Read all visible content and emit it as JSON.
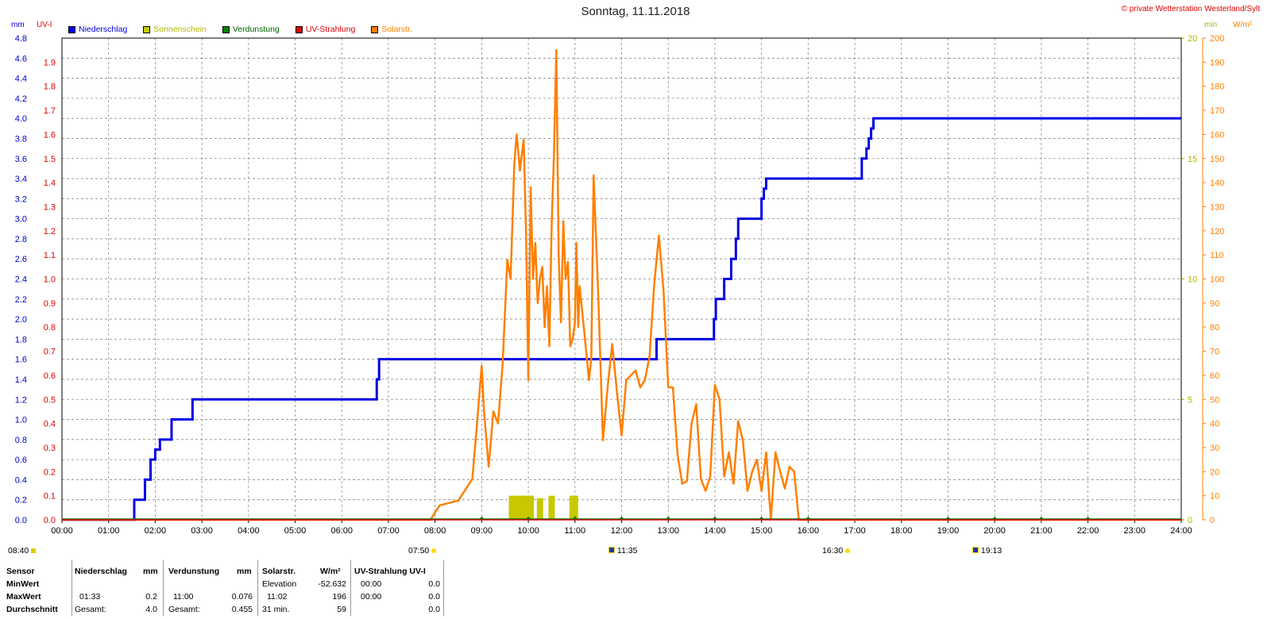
{
  "title": "Sonntag, 11.11.2018",
  "copyright": "© private Wetterstation Westerland/Sylt",
  "units": {
    "left1": "mm",
    "left2": "UV-I",
    "right1": "min",
    "right2": "W/m²"
  },
  "colors": {
    "niederschlag": "#0000e6",
    "sonnenschein": "#c8c800",
    "verdunstung": "#008000",
    "uv": "#e00000",
    "solar": "#ff7f00",
    "sonnenschein_axis": "#b4b400",
    "solar_axis": "#ff7f00"
  },
  "legend": [
    {
      "label": "Niederschlag",
      "color": "#0000e6"
    },
    {
      "label": "Sonnenschein",
      "color": "#c8c800"
    },
    {
      "label": "Verdunstung",
      "color": "#008000"
    },
    {
      "label": "UV-Strahlung",
      "color": "#e00000"
    },
    {
      "label": "Solarstr.",
      "color": "#ff7f00"
    }
  ],
  "chart_data": {
    "type": "line",
    "title": "Sonntag, 11.11.2018",
    "xlim": [
      0,
      24
    ],
    "x_ticks": [
      "00:00",
      "01:00",
      "02:00",
      "03:00",
      "04:00",
      "05:00",
      "06:00",
      "07:00",
      "08:00",
      "09:00",
      "10:00",
      "11:00",
      "12:00",
      "13:00",
      "14:00",
      "15:00",
      "16:00",
      "17:00",
      "18:00",
      "19:00",
      "20:00",
      "21:00",
      "22:00",
      "23:00",
      "24:00"
    ],
    "axes": {
      "mm": {
        "range": [
          0,
          4.8
        ],
        "ticks": [
          "0.0",
          "0.2",
          "0.4",
          "0.6",
          "0.8",
          "1.0",
          "1.2",
          "1.4",
          "1.6",
          "1.8",
          "2.0",
          "2.2",
          "2.4",
          "2.6",
          "2.8",
          "3.0",
          "3.2",
          "3.4",
          "3.6",
          "3.8",
          "4.0",
          "4.2",
          "4.4",
          "4.6",
          "4.8"
        ]
      },
      "uv": {
        "range": [
          0,
          2.0
        ],
        "ticks": [
          "0.0",
          "0.1",
          "0.2",
          "0.3",
          "0.4",
          "0.5",
          "0.6",
          "0.7",
          "0.8",
          "0.9",
          "1.0",
          "1.1",
          "1.2",
          "1.3",
          "1.4",
          "1.5",
          "1.6",
          "1.7",
          "1.8",
          "1.9"
        ]
      },
      "min": {
        "range": [
          0,
          20
        ],
        "ticks": [
          "0",
          "5",
          "10",
          "15",
          "20"
        ]
      },
      "wm2": {
        "range": [
          0,
          200
        ],
        "ticks": [
          "0",
          "10",
          "20",
          "30",
          "40",
          "50",
          "60",
          "70",
          "80",
          "90",
          "100",
          "110",
          "120",
          "130",
          "140",
          "150",
          "160",
          "170",
          "180",
          "190",
          "200"
        ]
      }
    },
    "series": [
      {
        "name": "Niederschlag",
        "unit": "mm",
        "axis": "mm",
        "step": true,
        "x": [
          0,
          1.5,
          1.55,
          1.78,
          1.9,
          2.0,
          2.1,
          2.35,
          2.8,
          6.7,
          6.75,
          6.8,
          12.75,
          13.98,
          14.02,
          14.2,
          14.35,
          14.45,
          14.5,
          15.0,
          15.05,
          15.1,
          17.15,
          17.25,
          17.3,
          17.35,
          17.4,
          24
        ],
        "values": [
          0,
          0,
          0.2,
          0.4,
          0.6,
          0.7,
          0.8,
          1.0,
          1.2,
          1.2,
          1.4,
          1.6,
          1.8,
          2.0,
          2.2,
          2.4,
          2.6,
          2.8,
          3.0,
          3.2,
          3.3,
          3.4,
          3.6,
          3.7,
          3.8,
          3.9,
          4.0,
          4.0
        ]
      },
      {
        "name": "Solarstr.",
        "unit": "W/m²",
        "axis": "wm2",
        "x": [
          0,
          7.9,
          8.1,
          8.3,
          8.5,
          8.8,
          8.9,
          9.0,
          9.05,
          9.15,
          9.25,
          9.35,
          9.45,
          9.55,
          9.62,
          9.7,
          9.75,
          9.82,
          9.9,
          9.95,
          10.0,
          10.05,
          10.1,
          10.15,
          10.2,
          10.25,
          10.3,
          10.35,
          10.4,
          10.45,
          10.5,
          10.55,
          10.6,
          10.65,
          10.7,
          10.75,
          10.8,
          10.85,
          10.9,
          10.95,
          11.0,
          11.03,
          11.07,
          11.1,
          11.2,
          11.3,
          11.35,
          11.4,
          11.5,
          11.6,
          11.7,
          11.8,
          11.9,
          12.0,
          12.1,
          12.2,
          12.3,
          12.4,
          12.5,
          12.6,
          12.7,
          12.8,
          12.9,
          13.0,
          13.1,
          13.2,
          13.3,
          13.4,
          13.5,
          13.6,
          13.7,
          13.8,
          13.9,
          14.0,
          14.1,
          14.2,
          14.3,
          14.4,
          14.5,
          14.6,
          14.7,
          14.8,
          14.9,
          15.0,
          15.1,
          15.2,
          15.3,
          15.4,
          15.5,
          15.6,
          15.7,
          15.8,
          15.9,
          16.0,
          16.1,
          16.2,
          24
        ],
        "values": [
          0,
          0,
          6,
          7,
          8,
          17,
          40,
          64,
          45,
          22,
          45,
          40,
          65,
          108,
          100,
          148,
          160,
          145,
          158,
          120,
          58,
          138,
          100,
          115,
          90,
          100,
          105,
          80,
          97,
          72,
          122,
          152,
          195,
          110,
          82,
          124,
          100,
          107,
          72,
          75,
          82,
          115,
          80,
          97,
          78,
          58,
          67,
          143,
          93,
          33,
          55,
          73,
          53,
          35,
          58,
          60,
          62,
          55,
          58,
          68,
          98,
          118,
          95,
          55,
          55,
          27,
          15,
          16,
          40,
          48,
          17,
          12,
          18,
          56,
          50,
          18,
          28,
          15,
          41,
          33,
          12,
          20,
          25,
          12,
          28,
          0,
          28,
          20,
          13,
          22,
          20,
          0,
          0,
          0,
          0,
          0,
          0
        ]
      },
      {
        "name": "Sonnenschein",
        "unit": "min",
        "axis": "min",
        "type": "bar",
        "x": [
          9.65,
          9.75,
          9.85,
          9.95,
          10.05,
          10.25,
          10.5,
          10.95,
          11.0
        ],
        "values": [
          1.0,
          1.0,
          1.0,
          1.0,
          1.0,
          0.9,
          1.0,
          1.0,
          1.0
        ]
      },
      {
        "name": "Verdunstung",
        "unit": "mm",
        "axis": "mm",
        "type": "markers",
        "x": [
          9.0,
          10.0,
          11.0,
          12.0,
          13.0,
          14.0,
          15.0,
          16.0,
          19.0,
          20.0,
          21.0,
          22.0
        ],
        "values": [
          0.02,
          0.04,
          0.076,
          0.05,
          0.04,
          0.03,
          0.02,
          0.01,
          0.005,
          0.005,
          0.005,
          0.005
        ]
      },
      {
        "name": "UV-Strahlung",
        "unit": "UV-I",
        "axis": "uv",
        "x": [
          0,
          24
        ],
        "values": [
          0,
          0
        ]
      }
    ]
  },
  "events": [
    {
      "label": "08:40",
      "icon": "moon"
    },
    {
      "label": "07:50",
      "icon": "sunrise"
    },
    {
      "label": "11:35",
      "icon": "moon-high"
    },
    {
      "label": "16:30",
      "icon": "sunset"
    },
    {
      "label": "19:13",
      "icon": "moonset"
    }
  ],
  "stats": {
    "headers": {
      "sensor": "Sensor",
      "niederschlag": "Niederschlag",
      "mm1": "mm",
      "verdunstung": "Verdunstung",
      "mm2": "mm",
      "solar": "Solarstr.",
      "wm2": "W/m²",
      "uv": "UV-Strahlung UV-I"
    },
    "rows": [
      {
        "label": "MinWert",
        "n_time": "",
        "n_val": "",
        "v_time": "",
        "v_val": "",
        "s_time": "Elevation",
        "s_val": "-52.632",
        "u_time": "00:00",
        "u_val": "0.0"
      },
      {
        "label": "MaxWert",
        "n_time": "01:33",
        "n_val": "0.2",
        "v_time": "11:00",
        "v_val": "0.076",
        "s_time": "11:02",
        "s_val": "196",
        "u_time": "00:00",
        "u_val": "0.0"
      },
      {
        "label": "Durchschnitt",
        "n_time": "Gesamt:",
        "n_val": "4.0",
        "v_time": "Gesamt:",
        "v_val": "0.455",
        "s_time": "31 min.",
        "s_val": "59",
        "u_time": "",
        "u_val": "0.0"
      }
    ]
  }
}
